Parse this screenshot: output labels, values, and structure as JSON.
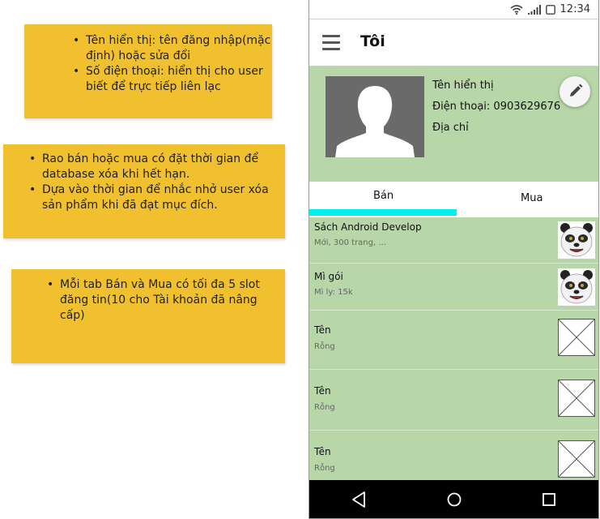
{
  "notes": {
    "profile": [
      "Tên hiển thị: tên đăng nhập(mặc định) hoặc sửa đổi",
      "Số điện thoại: hiển thị cho user biết để trực tiếp liên lạc"
    ],
    "posting": [
      "Rao bán hoặc mua có đặt thời gian để database xóa khi hết hạn.",
      "Dựa vào thời gian để nhắc nhở user xóa sản phẩm khi đã đạt mục đích."
    ],
    "slots": [
      "Mỗi tab Bán và Mua có tối đa 5 slot đăng tin(10 cho Tài khoản đã nâng cấp)"
    ]
  },
  "statusbar": {
    "time": "12:34"
  },
  "appbar": {
    "title": "Tôi"
  },
  "profile": {
    "display_name": "Tên hiển thị",
    "phone": "Điện thoại: 0903629676",
    "address": "Địa chỉ"
  },
  "tabs": [
    {
      "label": "Bán",
      "active": true
    },
    {
      "label": "Mua",
      "active": false
    }
  ],
  "listings": [
    {
      "title": "Sách Android Develop",
      "subtitle": "Mới, 300 trang, ..."
    },
    {
      "title": "Mì gói",
      "subtitle": "Mì ly: 15k"
    },
    {
      "title": "Tên",
      "subtitle": "Rỗng"
    },
    {
      "title": "Tên",
      "subtitle": "Rỗng"
    },
    {
      "title": "Tên",
      "subtitle": "Rỗng"
    }
  ],
  "colors": {
    "note": "#f0c02e",
    "profile_bg": "#b7d7a8",
    "tab_indicator": "#00f0f0",
    "navbar": "#000000"
  }
}
